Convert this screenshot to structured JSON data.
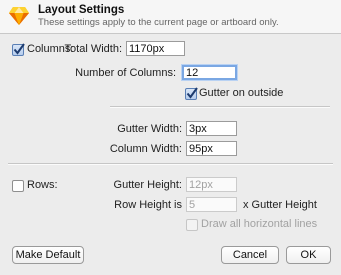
{
  "header": {
    "title": "Layout Settings",
    "subtitle": "These settings apply to the current page or artboard only."
  },
  "columns": {
    "label": "Columns:",
    "checked": true,
    "total_width_label": "Total Width:",
    "total_width_value": "1170px",
    "number_label": "Number of Columns:",
    "number_value": "12",
    "gutter_outside_label": "Gutter on outside",
    "gutter_outside_checked": true,
    "gutter_width_label": "Gutter Width:",
    "gutter_width_value": "3px",
    "column_width_label": "Column Width:",
    "column_width_value": "95px"
  },
  "rows": {
    "label": "Rows:",
    "checked": false,
    "gutter_height_label": "Gutter Height:",
    "gutter_height_value": "12px",
    "row_height_label": "Row Height is",
    "row_height_value": "5",
    "row_height_suffix": "x Gutter Height",
    "draw_lines_label": "Draw all horizontal lines",
    "draw_lines_checked": false
  },
  "buttons": {
    "make_default": "Make Default",
    "cancel": "Cancel",
    "ok": "OK"
  },
  "colors": {
    "accent": "#7aa7e3",
    "app_icon": "#f7b82c"
  },
  "icons": {
    "app": "sketch-diamond-icon",
    "check": "checkmark-icon"
  }
}
